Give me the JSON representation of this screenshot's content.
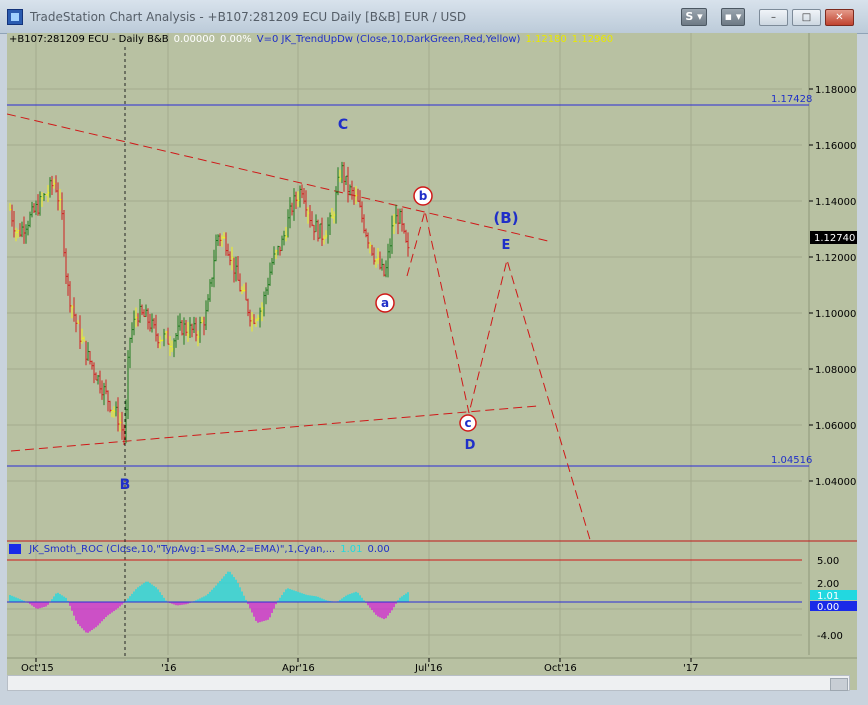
{
  "window": {
    "title": "TradeStation Chart Analysis - +B107:281209 ECU Daily [B&B] EUR / USD",
    "btn_s": "S ▾",
    "btn_lock": "▪ ▾",
    "min_icon": "–",
    "max_icon": "□",
    "close_icon": "✕"
  },
  "legend": {
    "symbol": "+B107:281209 ECU - Daily  B&B",
    "change": "0.00000",
    "pct": "0.00%",
    "indicator": "V=0  JK_TrendUpDw (Close,10,DarkGreen,Red,Yellow)",
    "val1": "1.12180",
    "val2": "1.12960"
  },
  "price_axis": {
    "ticks": [
      "1.18000",
      "1.16000",
      "1.14000",
      "1.12000",
      "1.10000",
      "1.08000",
      "1.06000",
      "1.04000"
    ],
    "current": "1.12740"
  },
  "levels": {
    "upper": "1.17428",
    "lower": "1.04516"
  },
  "waves": {
    "C": "C",
    "b": "b",
    "a": "a",
    "B_paren": "(B)",
    "E": "E",
    "c": "c",
    "D": "D",
    "B": "B"
  },
  "subpanel": {
    "legend": "JK_Smoth_ROC (Close,10,\"TypAvg:1=SMA,2=EMA)\",1,Cyan,...",
    "val1": "1.01",
    "val2": "0.00",
    "ticks": [
      "5.00",
      "2.00",
      "-4.00"
    ],
    "current_hi": "1.01",
    "current_lo": "0.00"
  },
  "time_axis": [
    "Oct'15",
    "'16",
    "Apr'16",
    "Jul'16",
    "Oct'16",
    "'17"
  ],
  "colors": {
    "up": "#1e7a1e",
    "down": "#d02020",
    "neutral": "#f0f020",
    "wave": "#1f2fc8",
    "trend": "#d01818",
    "roc": "#22d8e0",
    "roc_neg": "#d22ad2"
  }
}
